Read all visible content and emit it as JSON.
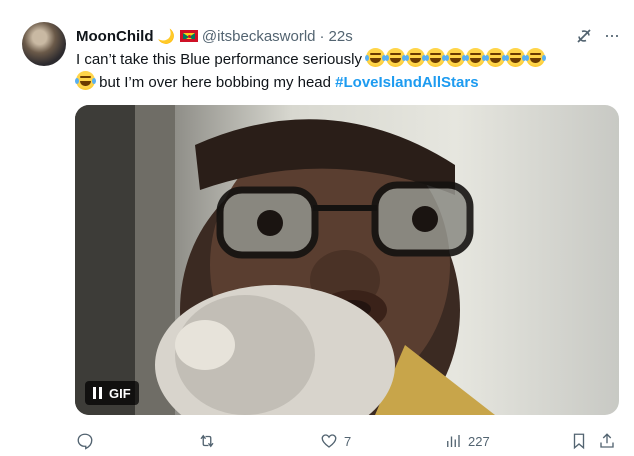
{
  "tweet": {
    "display_name": "MoonChild",
    "handle": "@itsbeckasworld",
    "separator": "·",
    "time": "22s",
    "text_line1": "I can’t take this Blue performance seriously",
    "text_line2": "but I’m over here bobbing my head",
    "hashtag": "#LoveIslandAllStars",
    "emoji_count_line1": 9,
    "emoji_count_line2": 1,
    "emoji_name": "face-with-tears-of-joy"
  },
  "media": {
    "badge_label": "GIF",
    "state": "paused"
  },
  "actions": {
    "reply_count": "",
    "retweet_count": "",
    "like_count": "7",
    "views_count": "227"
  },
  "colors": {
    "text": "#0f1419",
    "secondary": "#536471",
    "link": "#1d9bf0"
  }
}
